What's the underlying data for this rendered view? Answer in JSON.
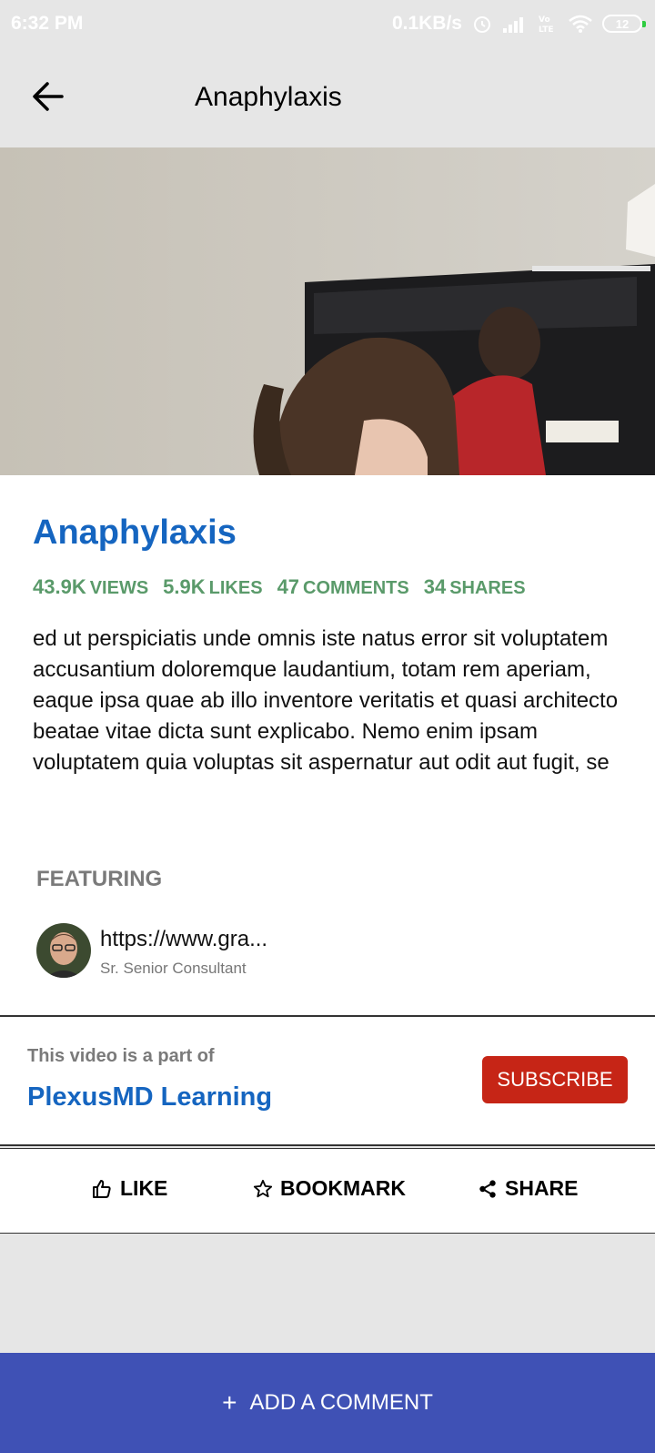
{
  "status_bar": {
    "time": "6:32 PM",
    "network_speed": "0.1KB/s",
    "battery": "12",
    "icons": [
      "alarm-icon",
      "signal-icon",
      "volte-icon",
      "wifi-icon",
      "battery-icon"
    ]
  },
  "app_bar": {
    "title": "Anaphylaxis",
    "back_icon": "arrow-left-icon"
  },
  "video": {
    "title": "Anaphylaxis",
    "stats": [
      {
        "value": "43.9K",
        "label": "VIEWS"
      },
      {
        "value": "5.9K",
        "label": "LIKES"
      },
      {
        "value": "47",
        "label": "COMMENTS"
      },
      {
        "value": "34",
        "label": "SHARES"
      }
    ],
    "description": "ed ut perspiciatis unde omnis iste natus error sit voluptatem accusantium doloremque laudantium, totam rem aperiam, eaque ipsa quae ab illo inventore veritatis et quasi architecto beatae vitae dicta sunt explicabo. Nemo enim ipsam voluptatem quia voluptas sit aspernatur aut odit aut fugit, se"
  },
  "featuring": {
    "label": "FEATURING",
    "name": "https://www.gra...",
    "role": "Sr. Senior Consultant"
  },
  "part_of": {
    "label": "This video is a part of",
    "name": "PlexusMD Learning",
    "subscribe_label": "SUBSCRIBE"
  },
  "actions": [
    {
      "label": "LIKE",
      "icon": "thumbs-up-icon"
    },
    {
      "label": "BOOKMARK",
      "icon": "star-icon"
    },
    {
      "label": "SHARE",
      "icon": "share-icon"
    }
  ],
  "comment_bar": {
    "label": "ADD A COMMENT",
    "icon": "plus-icon"
  },
  "colors": {
    "accent_blue": "#1565c0",
    "stats_green": "#5a9a6a",
    "subscribe_red": "#c62516",
    "comment_bar": "#3f51b5"
  }
}
